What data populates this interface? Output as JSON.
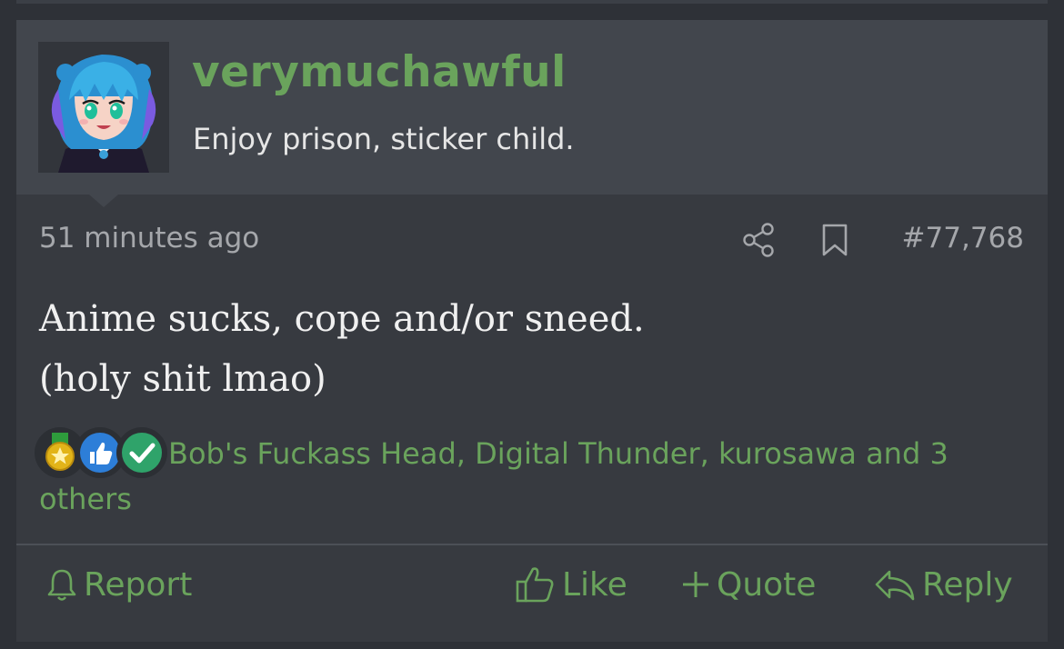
{
  "post": {
    "username": "verymuchawful",
    "user_title": "Enjoy prison, sticker child.",
    "timestamp": "51 minutes ago",
    "post_number": "#77,768",
    "message_lines": [
      "Anime sucks, cope and/or sneed.",
      "(holy shit lmao)"
    ],
    "reactions": {
      "icons": [
        "medal-icon",
        "like-icon",
        "checkmark-icon"
      ],
      "text": "Bob's Fuckass Head, Digital Thunder, kurosawa and 3 others"
    },
    "actions": {
      "report": "Report",
      "like": "Like",
      "quote": "Quote",
      "reply": "Reply"
    }
  },
  "colors": {
    "accent": "#6aa35c",
    "header_bg": "#42464d",
    "post_bg": "#373a40",
    "page_bg": "#2e3137"
  }
}
